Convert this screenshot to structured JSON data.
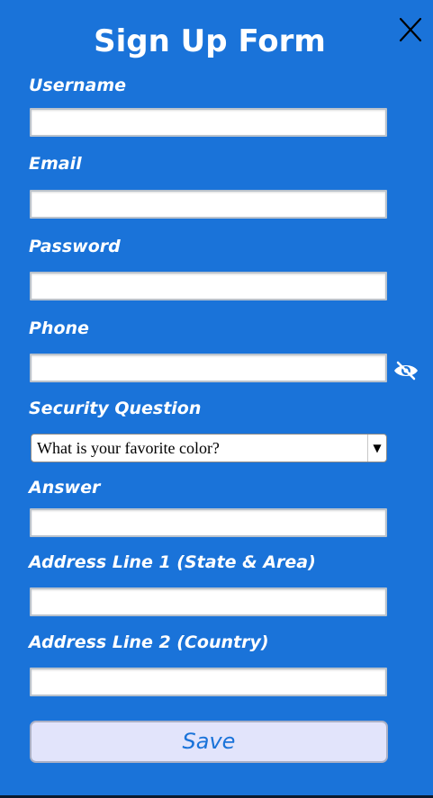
{
  "form": {
    "title": "Sign Up Form",
    "fields": {
      "username": {
        "label": "Username",
        "value": ""
      },
      "email": {
        "label": "Email",
        "value": ""
      },
      "password": {
        "label": "Password",
        "value": ""
      },
      "phone": {
        "label": "Phone",
        "value": ""
      },
      "security_question": {
        "label": "Security Question",
        "selected": "What is your favorite color?"
      },
      "answer": {
        "label": "Answer",
        "value": ""
      },
      "address1": {
        "label": "Address Line 1 (State & Area)",
        "value": ""
      },
      "address2": {
        "label": "Address Line 2 (Country)",
        "value": ""
      }
    },
    "save_label": "Save"
  },
  "icons": {
    "close": "close-icon",
    "eye": "eye-hidden-icon",
    "dropdown": "dropdown-arrow-icon"
  },
  "colors": {
    "background": "#1a73d9",
    "button_bg": "#e2e4fb",
    "button_text": "#1a73d9"
  }
}
